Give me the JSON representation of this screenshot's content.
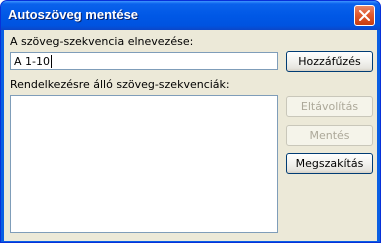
{
  "window": {
    "title": "Autoszöveg mentése",
    "close_icon": "close-icon"
  },
  "form": {
    "name_label": "A szöveg-szekvencia elnevezése:",
    "name_value": "A 1-10",
    "list_label": "Rendelkezésre álló szöveg-szekvenciák:",
    "list_items": []
  },
  "buttons": {
    "add": {
      "label": "Hozzáfűzés",
      "enabled": true
    },
    "remove": {
      "label": "Eltávolítás",
      "enabled": false
    },
    "save": {
      "label": "Mentés",
      "enabled": false
    },
    "cancel": {
      "label": "Megszakítás",
      "enabled": true
    }
  },
  "colors": {
    "title_bar": "#0058e6",
    "dialog_bg": "#ece9d8",
    "close_button": "#e05a2f"
  }
}
